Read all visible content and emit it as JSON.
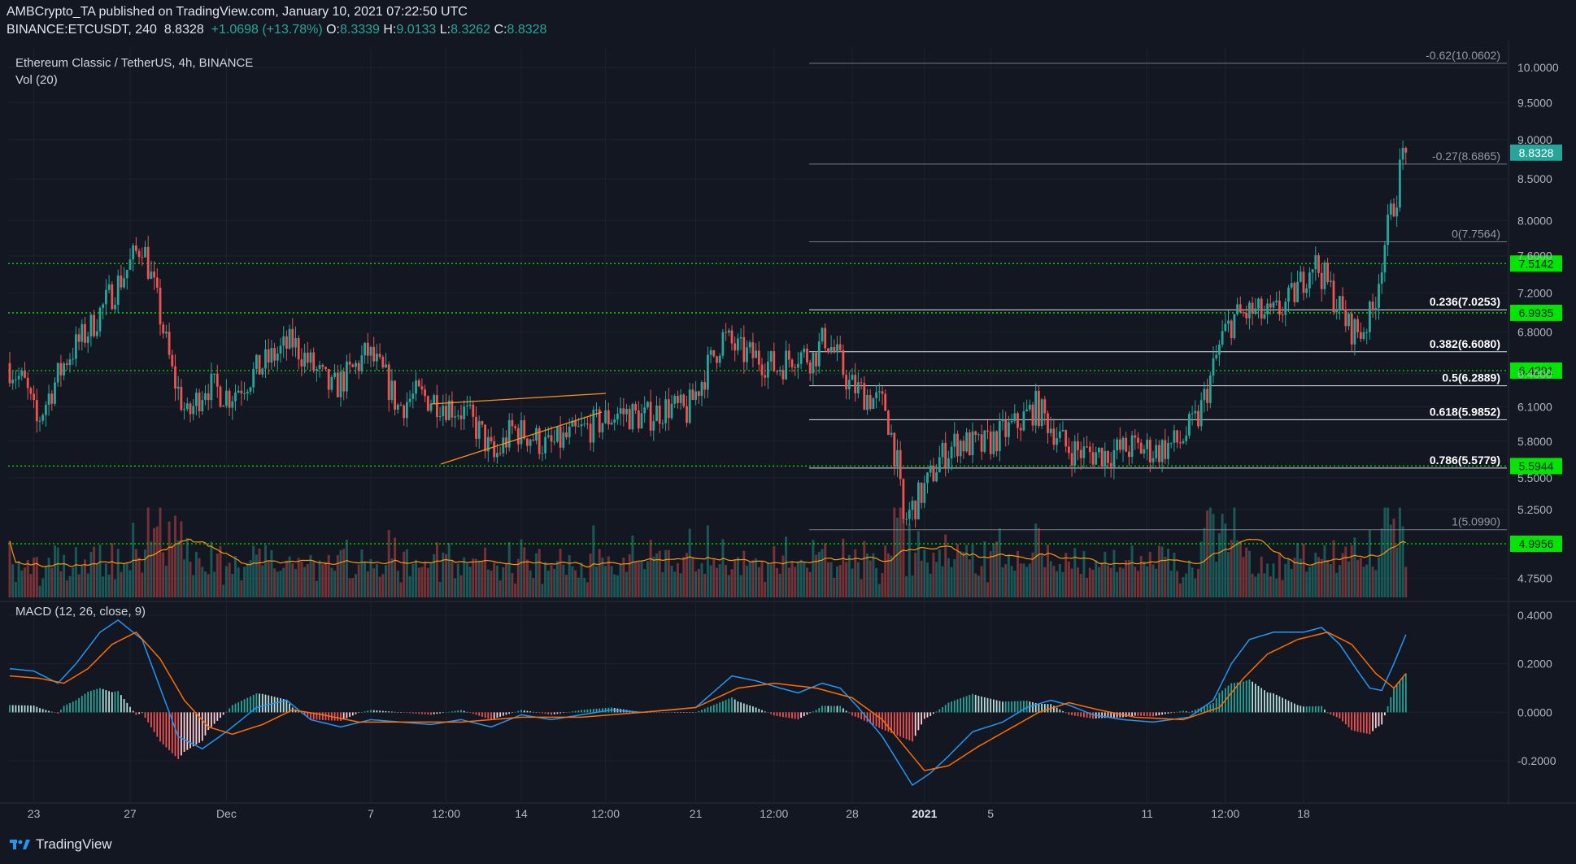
{
  "header": {
    "published_by": "AMBCrypto_TA published on TradingView.com, January 10, 2021 07:22:50 UTC",
    "symbol": "BINANCE:ETCUSDT, 240",
    "last": "8.8328",
    "change": "+1.0698 (+13.78%)",
    "o_label": "O:",
    "o_value": "8.3339",
    "h_label": "H:",
    "h_value": "9.0133",
    "l_label": "L:",
    "l_value": "8.3262",
    "c_label": "C:",
    "c_value": "8.8328"
  },
  "chart_title": "Ethereum Classic / TetherUS, 4h, BINANCE",
  "volume_label": "Vol (20)",
  "macd_label": "MACD (12, 26, close, 9)",
  "footer": {
    "brand": "TradingView"
  },
  "colors": {
    "background": "#131722",
    "bull": "#26a69a",
    "bear": "#ef5350",
    "support_line": "#00e600",
    "fib_line": "#b2b5be",
    "macd_line": "#2196f3",
    "signal_line": "#ff6d00",
    "triangle": "#f7931a"
  },
  "chart_data": {
    "type": "candlestick",
    "symbol": "ETCUSDT",
    "timeframe": "4h",
    "x_tick_labels": [
      "23",
      "27",
      "Dec",
      "7",
      "12:00",
      "14",
      "12:00",
      "21",
      "12:00",
      "28",
      "2021",
      "5",
      "11",
      "12:00",
      "18"
    ],
    "price_ticks": [
      "10.0000",
      "9.5000",
      "9.0000",
      "8.5000",
      "8.0000",
      "7.6000",
      "7.2000",
      "6.8000",
      "6.4000",
      "6.1000",
      "5.8000",
      "5.5000",
      "5.2500",
      "4.7500"
    ],
    "price_axis_scale": "log",
    "ylim": [
      4.62,
      10.3
    ],
    "support_levels": [
      "7.5142",
      "6.9935",
      "6.4291",
      "5.5944",
      "4.9956"
    ],
    "last_price_label": "8.8328",
    "fibonacci": [
      {
        "label": "-0.62(10.0602)",
        "value": 10.0602
      },
      {
        "label": "-0.27(8.6865)",
        "value": 8.6865
      },
      {
        "label": "0(7.7564)",
        "value": 7.7564
      },
      {
        "label": "0.236(7.0253)",
        "value": 7.0253
      },
      {
        "label": "0.382(6.6080)",
        "value": 6.608
      },
      {
        "label": "0.5(6.2889)",
        "value": 6.2889
      },
      {
        "label": "0.618(5.9852)",
        "value": 5.9852
      },
      {
        "label": "0.786(5.5779)",
        "value": 5.5779
      },
      {
        "label": "1(5.0990)",
        "value": 5.099
      }
    ],
    "price_path": [
      [
        0,
        6.5
      ],
      [
        6,
        6.3
      ],
      [
        10,
        5.95
      ],
      [
        14,
        6.2
      ],
      [
        20,
        6.55
      ],
      [
        28,
        6.85
      ],
      [
        34,
        7.15
      ],
      [
        40,
        7.45
      ],
      [
        45,
        7.75
      ],
      [
        50,
        7.1
      ],
      [
        55,
        6.4
      ],
      [
        60,
        6.0
      ],
      [
        66,
        6.3
      ],
      [
        74,
        6.2
      ],
      [
        80,
        6.35
      ],
      [
        88,
        6.55
      ],
      [
        95,
        6.7
      ],
      [
        102,
        6.45
      ],
      [
        108,
        6.25
      ],
      [
        114,
        6.4
      ],
      [
        120,
        6.6
      ],
      [
        126,
        6.35
      ],
      [
        130,
        6.1
      ],
      [
        136,
        6.2
      ],
      [
        144,
        6.15
      ],
      [
        152,
        6.05
      ],
      [
        158,
        5.85
      ],
      [
        162,
        5.65
      ],
      [
        168,
        5.9
      ],
      [
        174,
        5.85
      ],
      [
        180,
        5.75
      ],
      [
        188,
        5.85
      ],
      [
        196,
        5.95
      ],
      [
        204,
        6.05
      ],
      [
        212,
        6.0
      ],
      [
        220,
        6.1
      ],
      [
        226,
        6.05
      ],
      [
        232,
        6.4
      ],
      [
        238,
        6.75
      ],
      [
        244,
        6.6
      ],
      [
        250,
        6.55
      ],
      [
        256,
        6.45
      ],
      [
        262,
        6.6
      ],
      [
        268,
        6.55
      ],
      [
        272,
        6.75
      ],
      [
        276,
        6.55
      ],
      [
        280,
        6.3
      ],
      [
        286,
        6.2
      ],
      [
        292,
        6.1
      ],
      [
        296,
        5.6
      ],
      [
        298,
        5.15
      ],
      [
        302,
        5.3
      ],
      [
        306,
        5.45
      ],
      [
        310,
        5.65
      ],
      [
        316,
        5.8
      ],
      [
        324,
        5.75
      ],
      [
        330,
        5.85
      ],
      [
        336,
        5.95
      ],
      [
        342,
        6.1
      ],
      [
        348,
        5.9
      ],
      [
        352,
        5.75
      ],
      [
        358,
        5.7
      ],
      [
        366,
        5.7
      ],
      [
        374,
        5.75
      ],
      [
        382,
        5.72
      ],
      [
        390,
        5.8
      ],
      [
        396,
        6.0
      ],
      [
        400,
        6.35
      ],
      [
        404,
        6.75
      ],
      [
        408,
        6.95
      ],
      [
        414,
        7.0
      ],
      [
        420,
        6.95
      ],
      [
        426,
        7.1
      ],
      [
        430,
        7.3
      ],
      [
        434,
        7.55
      ],
      [
        438,
        7.35
      ],
      [
        442,
        7.1
      ],
      [
        446,
        6.85
      ],
      [
        450,
        6.8
      ],
      [
        454,
        7.0
      ],
      [
        458,
        7.75
      ],
      [
        462,
        8.35
      ],
      [
        464,
        8.83
      ]
    ],
    "macd_ticks": [
      "0.4000",
      "0.2000",
      "0.0000",
      "-0.2000"
    ],
    "macd_ylim": [
      -0.33,
      0.45
    ],
    "macd_path": [
      [
        0,
        0.18
      ],
      [
        8,
        0.17
      ],
      [
        16,
        0.12
      ],
      [
        22,
        0.2
      ],
      [
        30,
        0.33
      ],
      [
        36,
        0.38
      ],
      [
        44,
        0.3
      ],
      [
        50,
        0.1
      ],
      [
        56,
        -0.1
      ],
      [
        64,
        -0.15
      ],
      [
        72,
        -0.08
      ],
      [
        82,
        0.02
      ],
      [
        92,
        0.05
      ],
      [
        100,
        -0.03
      ],
      [
        110,
        -0.06
      ],
      [
        120,
        -0.03
      ],
      [
        130,
        -0.04
      ],
      [
        140,
        -0.05
      ],
      [
        150,
        -0.03
      ],
      [
        160,
        -0.06
      ],
      [
        170,
        -0.01
      ],
      [
        180,
        -0.03
      ],
      [
        190,
        -0.01
      ],
      [
        200,
        0.01
      ],
      [
        210,
        0.0
      ],
      [
        220,
        0.01
      ],
      [
        228,
        0.02
      ],
      [
        240,
        0.15
      ],
      [
        248,
        0.13
      ],
      [
        256,
        0.1
      ],
      [
        262,
        0.08
      ],
      [
        270,
        0.12
      ],
      [
        276,
        0.1
      ],
      [
        282,
        0.02
      ],
      [
        290,
        -0.1
      ],
      [
        296,
        -0.22
      ],
      [
        300,
        -0.3
      ],
      [
        306,
        -0.25
      ],
      [
        312,
        -0.18
      ],
      [
        320,
        -0.08
      ],
      [
        330,
        -0.04
      ],
      [
        338,
        0.02
      ],
      [
        346,
        0.05
      ],
      [
        352,
        0.03
      ],
      [
        360,
        -0.01
      ],
      [
        370,
        -0.03
      ],
      [
        380,
        -0.04
      ],
      [
        392,
        -0.02
      ],
      [
        400,
        0.05
      ],
      [
        406,
        0.2
      ],
      [
        412,
        0.3
      ],
      [
        420,
        0.33
      ],
      [
        430,
        0.33
      ],
      [
        436,
        0.35
      ],
      [
        442,
        0.28
      ],
      [
        448,
        0.17
      ],
      [
        452,
        0.1
      ],
      [
        456,
        0.09
      ],
      [
        460,
        0.2
      ],
      [
        464,
        0.32
      ]
    ],
    "signal_path": [
      [
        0,
        0.15
      ],
      [
        10,
        0.14
      ],
      [
        18,
        0.12
      ],
      [
        26,
        0.18
      ],
      [
        34,
        0.28
      ],
      [
        42,
        0.33
      ],
      [
        50,
        0.22
      ],
      [
        58,
        0.05
      ],
      [
        66,
        -0.06
      ],
      [
        74,
        -0.09
      ],
      [
        84,
        -0.05
      ],
      [
        94,
        0.01
      ],
      [
        104,
        -0.01
      ],
      [
        116,
        -0.04
      ],
      [
        130,
        -0.04
      ],
      [
        150,
        -0.04
      ],
      [
        170,
        -0.02
      ],
      [
        190,
        -0.02
      ],
      [
        210,
        0.0
      ],
      [
        228,
        0.02
      ],
      [
        242,
        0.1
      ],
      [
        254,
        0.12
      ],
      [
        268,
        0.1
      ],
      [
        280,
        0.06
      ],
      [
        290,
        -0.03
      ],
      [
        298,
        -0.15
      ],
      [
        304,
        -0.24
      ],
      [
        312,
        -0.22
      ],
      [
        322,
        -0.14
      ],
      [
        332,
        -0.07
      ],
      [
        342,
        0.0
      ],
      [
        352,
        0.04
      ],
      [
        362,
        0.01
      ],
      [
        374,
        -0.02
      ],
      [
        390,
        -0.03
      ],
      [
        402,
        0.02
      ],
      [
        410,
        0.14
      ],
      [
        418,
        0.24
      ],
      [
        428,
        0.3
      ],
      [
        438,
        0.33
      ],
      [
        446,
        0.28
      ],
      [
        454,
        0.16
      ],
      [
        460,
        0.1
      ],
      [
        464,
        0.16
      ]
    ]
  }
}
